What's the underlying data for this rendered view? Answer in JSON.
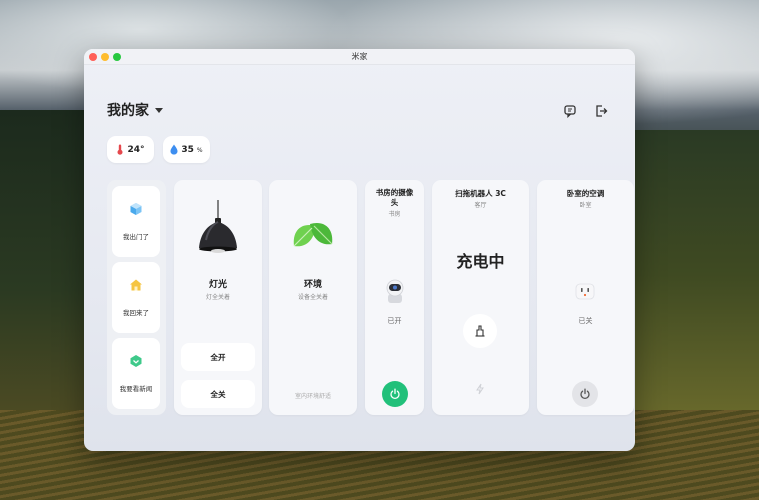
{
  "window": {
    "title": "米家"
  },
  "header": {
    "home_name": "我的家",
    "icons": [
      "message-icon",
      "logout-icon"
    ]
  },
  "chips": [
    {
      "icon": "thermometer-icon",
      "value": "24°",
      "unit": ""
    },
    {
      "icon": "humidity-drop-icon",
      "value": "35",
      "unit": "%"
    }
  ],
  "scenes": [
    {
      "icon": "cube-icon",
      "label": "我出门了"
    },
    {
      "icon": "home-icon",
      "label": "我回来了"
    },
    {
      "icon": "gem-icon",
      "label": "我要看新闻"
    }
  ],
  "light": {
    "name": "灯光",
    "status": "灯全关着",
    "on_label": "全开",
    "off_label": "全关"
  },
  "env": {
    "name": "环境",
    "status": "设备全关着",
    "footer": "室内环境舒适"
  },
  "camera": {
    "name": "书房的摄像头",
    "room": "书房",
    "state": "已开"
  },
  "robot": {
    "name": "扫拖机器人 3C",
    "room": "客厅",
    "state": "充电中"
  },
  "ac": {
    "name": "卧室的空调",
    "room": "卧室",
    "state": "已关"
  },
  "colors": {
    "accent_green": "#21c07a",
    "power_off_gray": "#e3e4e8"
  }
}
